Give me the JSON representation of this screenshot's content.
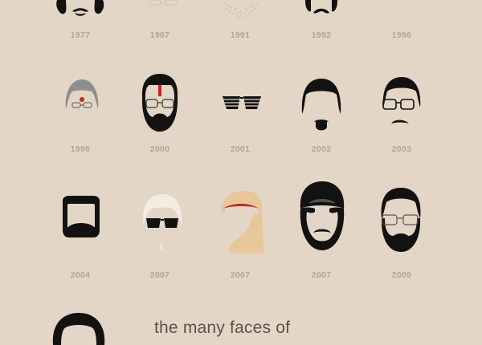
{
  "poster": {
    "caption": "the many faces of",
    "faces": [
      {
        "year": "1977",
        "icon": "curly-hair-mustache-face-icon"
      },
      {
        "year": "1987",
        "icon": "glasses-faint-face-icon"
      },
      {
        "year": "1991",
        "icon": "stubble-beard-face-icon"
      },
      {
        "year": "1992",
        "icon": "mustache-face-icon"
      },
      {
        "year": "1996",
        "icon": "blank-face-icon"
      },
      {
        "year": "1996",
        "icon": "bindi-lady-face-icon"
      },
      {
        "year": "2000",
        "icon": "tilak-beard-glasses-face-icon"
      },
      {
        "year": "2001",
        "icon": "shutter-shades-face-icon"
      },
      {
        "year": "2002",
        "icon": "goatee-face-icon"
      },
      {
        "year": "2003",
        "icon": "glasses-mustache-face-icon"
      },
      {
        "year": "2004",
        "icon": "square-beard-face-icon"
      },
      {
        "year": "2007",
        "icon": "white-hair-sunglasses-face-icon"
      },
      {
        "year": "2007",
        "icon": "headscarf-face-icon"
      },
      {
        "year": "2007",
        "icon": "turban-face-icon"
      },
      {
        "year": "2009",
        "icon": "full-beard-glasses-face-icon"
      },
      {
        "year": "",
        "icon": "long-hair-face-icon"
      }
    ],
    "colors": {
      "background": "#e3d6c6",
      "hair": "#121212",
      "year_text": "#b2a595",
      "caption_text": "#5a524b",
      "skin_light": "#f4ece2",
      "scarf": "#e8c79a",
      "bindi": "#c0291f"
    }
  }
}
